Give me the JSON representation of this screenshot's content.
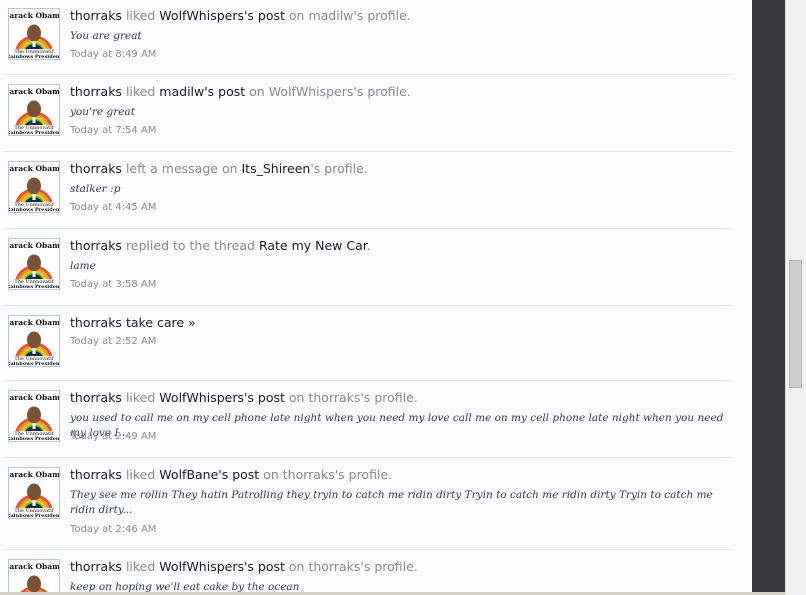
{
  "feed": {
    "items": [
      {
        "user": "thorraks",
        "action": "liked",
        "target": "WolfWhispers's post",
        "prep": "on",
        "place": "madilw's profile.",
        "snippet": "You are great",
        "time": "Today at 8:49 AM"
      },
      {
        "user": "thorraks",
        "action": "liked",
        "target": "madilw's post",
        "prep": "on",
        "place": "WolfWhispers's profile.",
        "snippet": "you're great",
        "time": "Today at 7:54 AM"
      },
      {
        "user": "thorraks",
        "action": "left a message on",
        "target": "Its_Shireen",
        "prep": "",
        "place": "'s profile.",
        "snippet": "stalker :p",
        "time": "Today at 4:45 AM"
      },
      {
        "user": "thorraks",
        "action": "replied to the thread",
        "target": "Rate my New Car",
        "prep": "",
        "place": ".",
        "snippet": "lame",
        "time": "Today at 3:58 AM"
      },
      {
        "user": "thorraks",
        "action": "",
        "target": "take care »",
        "prep": "",
        "place": "",
        "snippet": "",
        "time": "Today at 2:52 AM"
      },
      {
        "user": "thorraks",
        "action": "liked",
        "target": "WolfWhispers's post",
        "prep": "on",
        "place": "thorraks's profile.",
        "snippet": "you used to call me on my cell phone late night when you need my love call me on my cell phone late night when you need my love I...",
        "time": "Today at 2:49 AM"
      },
      {
        "user": "thorraks",
        "action": "liked",
        "target": "WolfBane's post",
        "prep": "on",
        "place": "thorraks's profile.",
        "snippet": "They see me rollin They hatin Patrolling they tryin to catch me ridin dirty Tryin to catch me ridin dirty Tryin to catch me ridin dirty...",
        "time": "Today at 2:46 AM"
      },
      {
        "user": "thorraks",
        "action": "liked",
        "target": "WolfWhispers's post",
        "prep": "on",
        "place": "thorraks's profile.",
        "snippet": "keep on hoping we'll eat cake by the ocean",
        "time": ""
      }
    ]
  },
  "avatar": {
    "top_text": "Barack Obama",
    "bottom_text_1": "The Unnnovatif",
    "bottom_text_2": "Rainbows President"
  },
  "colors": {
    "page_bg": "#fcfcff",
    "divider": "#dfe6ef",
    "username": "#1a1a2e",
    "muted": "#8a8a8a",
    "snippet": "#2b3a5a",
    "side_dark": "#3b3a40",
    "scrollbar": "#f0f0f0"
  }
}
